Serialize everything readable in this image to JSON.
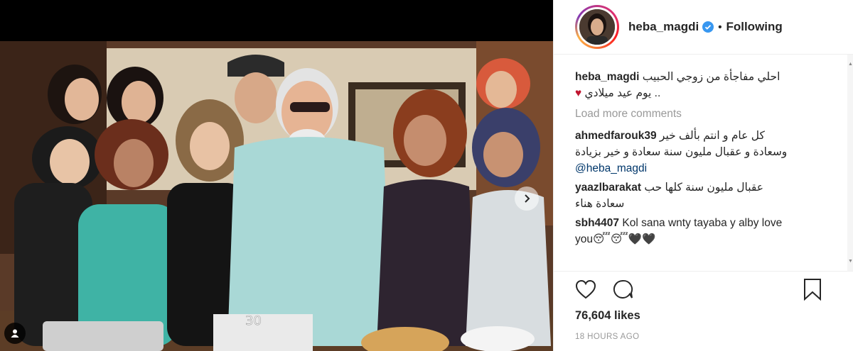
{
  "post": {
    "username": "heba_magdi",
    "follow_status": "Following",
    "dot": "•",
    "caption_user": "heba_magdi",
    "caption_line1": "احلي مفاجأة من زوجي الحبيب",
    "caption_line2": ".. يوم عيد ميلادي",
    "caption_heart": "♥",
    "load_more": "Load more comments",
    "comments": [
      {
        "user": "ahmedfarouk39",
        "line1": "كل عام و انتم بألف خير",
        "line2": "وسعادة و عقبال مليون سنة سعادة و خير بزيادة",
        "mention": "@heba_magdi"
      },
      {
        "user": "yaazlbarakat",
        "line1": "عقبال مليون سنة كلها حب",
        "line2": "سعادة هناء"
      },
      {
        "user": "sbh4407",
        "line1": "Kol sana wnty tayaba y alby love",
        "line2": "you😴😴🖤🖤"
      }
    ],
    "likes": "76,604 likes",
    "time": "18 HOURS AGO"
  },
  "colors": {
    "verified": "#3897f0",
    "heart": "#c0152f",
    "muted": "#999999"
  },
  "icons": [
    "user-tag-icon",
    "next-arrow-icon",
    "verified-badge-icon",
    "like-icon",
    "comment-icon",
    "save-icon"
  ]
}
